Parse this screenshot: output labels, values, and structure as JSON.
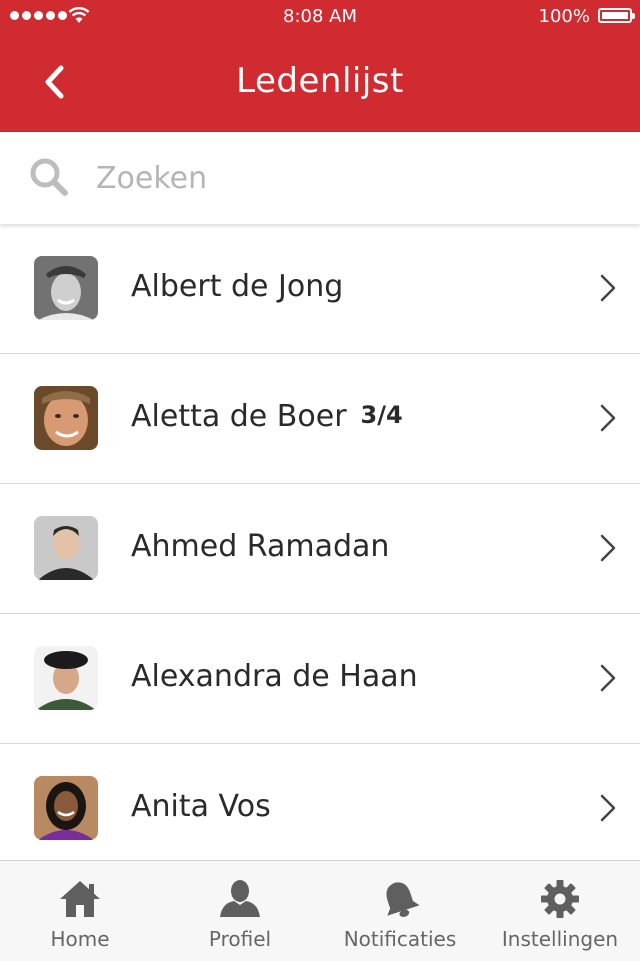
{
  "status": {
    "time": "8:08 AM",
    "battery": "100%"
  },
  "header": {
    "title": "Ledenlijst"
  },
  "search": {
    "placeholder": "Zoeken",
    "value": ""
  },
  "members": [
    {
      "name": "Albert de Jong",
      "count": ""
    },
    {
      "name": "Aletta de Boer",
      "count": "3/4"
    },
    {
      "name": "Ahmed Ramadan",
      "count": ""
    },
    {
      "name": "Alexandra de Haan",
      "count": ""
    },
    {
      "name": "Anita Vos",
      "count": ""
    }
  ],
  "tabs": [
    {
      "label": "Home",
      "icon": "home-icon"
    },
    {
      "label": "Profiel",
      "icon": "profile-icon"
    },
    {
      "label": "Notificaties",
      "icon": "bell-icon"
    },
    {
      "label": "Instellingen",
      "icon": "gear-icon"
    }
  ],
  "colors": {
    "header": "#cf2b31",
    "tab_icon": "#5f5f5f"
  }
}
